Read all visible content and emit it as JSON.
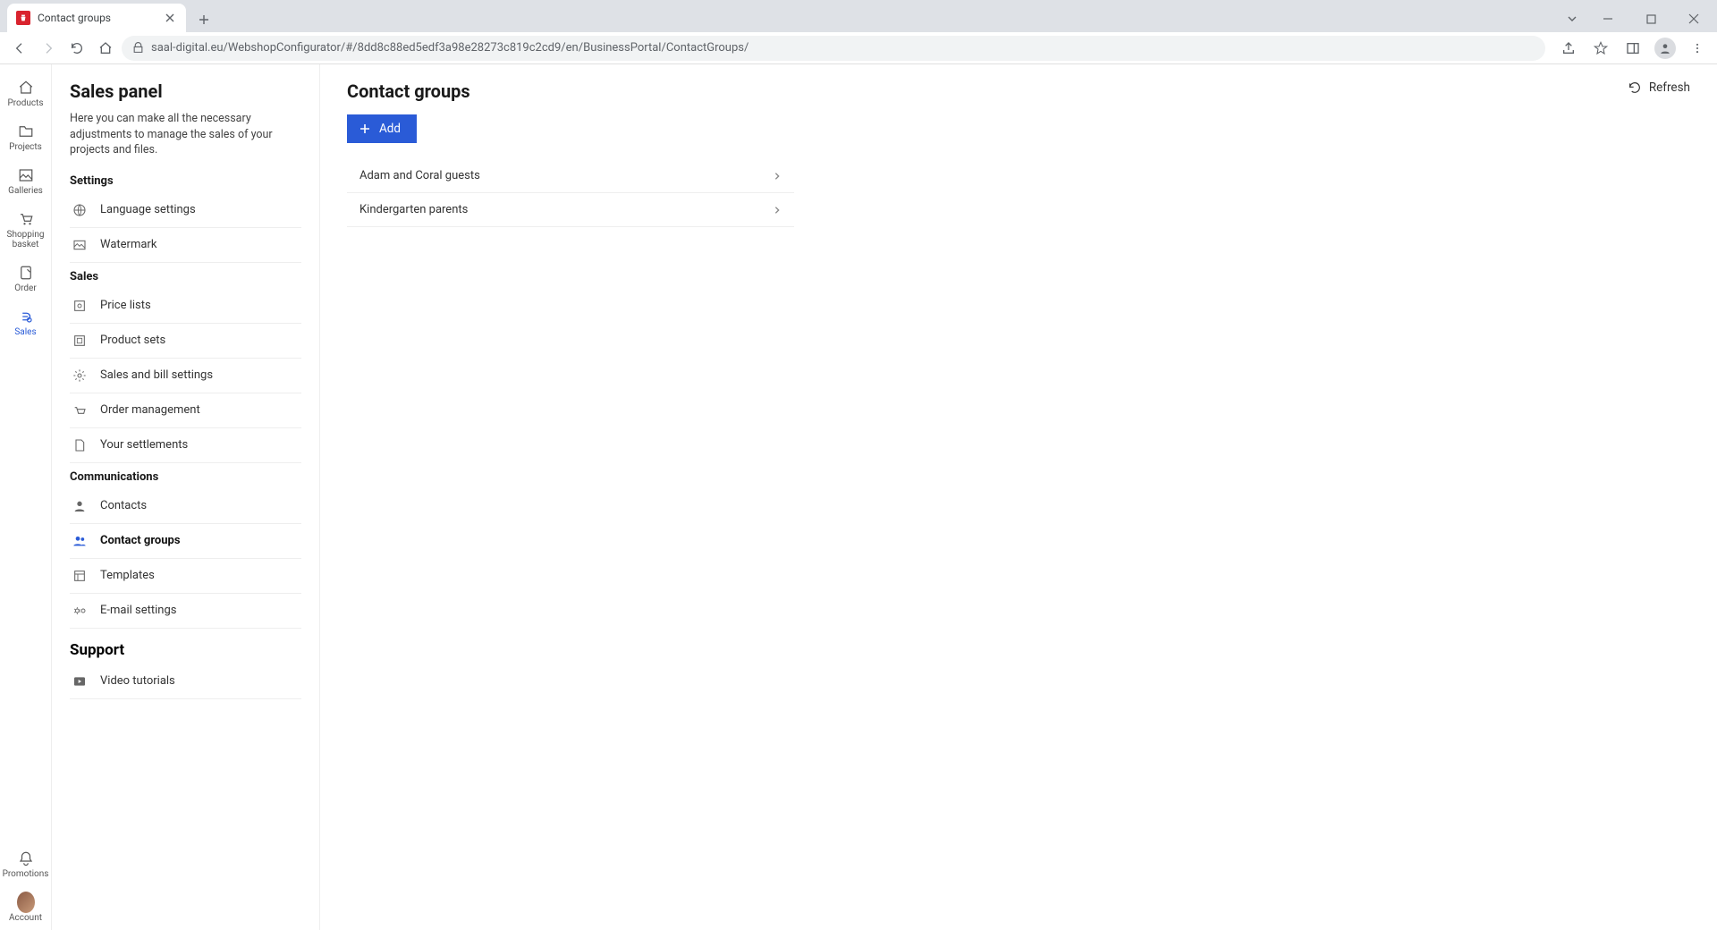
{
  "browser": {
    "tab_title": "Contact groups",
    "url": "saal-digital.eu/WebshopConfigurator/#/8dd8c88ed5edf3a98e28273c819c2cd9/en/BusinessPortal/ContactGroups/"
  },
  "rail": {
    "items": [
      {
        "label": "Products"
      },
      {
        "label": "Projects"
      },
      {
        "label": "Galleries"
      },
      {
        "label": "Shopping basket"
      },
      {
        "label": "Order"
      },
      {
        "label": "Sales"
      }
    ],
    "bottom": [
      {
        "label": "Promotions"
      },
      {
        "label": "Account"
      }
    ]
  },
  "panel": {
    "title": "Sales panel",
    "description": "Here you can make all the necessary adjustments to manage the sales of your projects and files.",
    "sections": {
      "settings": {
        "heading": "Settings",
        "items": [
          {
            "label": "Language settings"
          },
          {
            "label": "Watermark"
          }
        ]
      },
      "sales": {
        "heading": "Sales",
        "items": [
          {
            "label": "Price lists"
          },
          {
            "label": "Product sets"
          },
          {
            "label": "Sales and bill settings"
          },
          {
            "label": "Order management"
          },
          {
            "label": "Your settlements"
          }
        ]
      },
      "communications": {
        "heading": "Communications",
        "items": [
          {
            "label": "Contacts"
          },
          {
            "label": "Contact groups"
          },
          {
            "label": "Templates"
          },
          {
            "label": "E-mail settings"
          }
        ]
      },
      "support": {
        "heading": "Support",
        "items": [
          {
            "label": "Video tutorials"
          }
        ]
      }
    }
  },
  "main": {
    "title": "Contact groups",
    "refresh_label": "Refresh",
    "add_label": "Add",
    "groups": [
      {
        "name": "Adam and Coral guests"
      },
      {
        "name": "Kindergarten parents"
      }
    ]
  }
}
